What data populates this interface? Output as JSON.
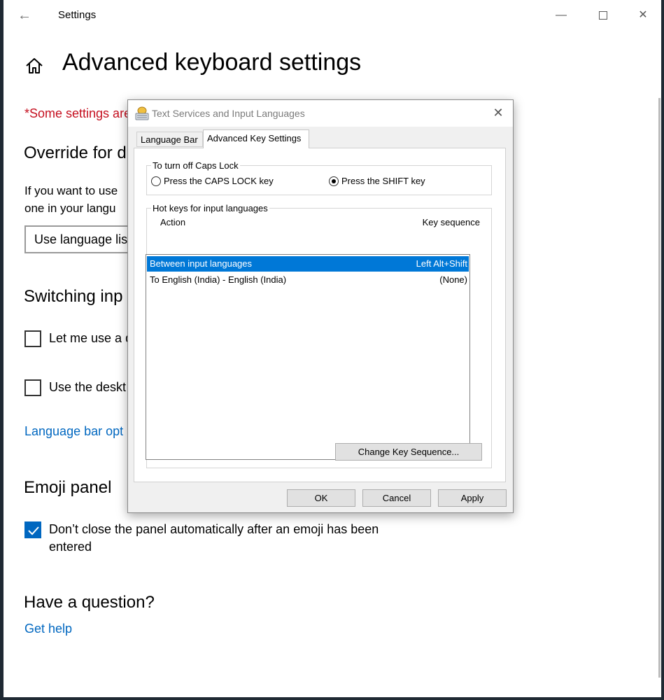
{
  "settings": {
    "title": "Settings",
    "page_title": "Advanced keyboard settings",
    "note": "*Some settings are",
    "override_heading": "Override for d",
    "override_text_1": "If you want to use",
    "override_text_2": "one in your langu",
    "dropdown_value": "Use language lis",
    "switching_heading": "Switching inp",
    "checkbox_1_label": "Let me use a d",
    "checkbox_2_label": "Use the deskt",
    "language_bar_link": "Language bar opt",
    "emoji_heading": "Emoji panel",
    "emoji_checkbox_label_1": "Don’t close the panel automatically after an emoji has been",
    "emoji_checkbox_label_2": "entered",
    "question_heading": "Have a question?",
    "get_help_link": "Get help"
  },
  "dialog": {
    "title": "Text Services and Input Languages",
    "tabs": [
      {
        "label": "Language Bar"
      },
      {
        "label": "Advanced Key Settings"
      }
    ],
    "caps_group_label": "To turn off Caps Lock",
    "radio_caps_label": "Press the CAPS LOCK key",
    "radio_shift_label": "Press the SHIFT key",
    "hotkeys_group_label": "Hot keys for input languages",
    "col_action": "Action",
    "col_key_sequence": "Key sequence",
    "rows": [
      {
        "action": "Between input languages",
        "key": "Left Alt+Shift"
      },
      {
        "action": "To English (India) - English (India)",
        "key": "(None)"
      }
    ],
    "change_key_button": "Change Key Sequence...",
    "ok_button": "OK",
    "cancel_button": "Cancel",
    "apply_button": "Apply"
  },
  "colors": {
    "accent": "#0067c0",
    "selection": "#0078d7",
    "warning": "#c50f1f"
  }
}
